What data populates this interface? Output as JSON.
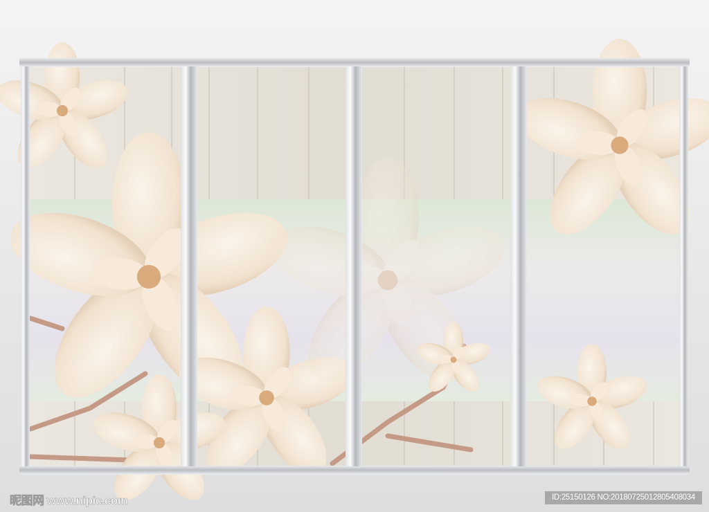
{
  "watermark": {
    "site_logo": "昵图网",
    "site_url": "www.nipic.com",
    "image_id": "ID:25150126 NO:20180725012805408034"
  },
  "colors": {
    "wood": "#e8e3da",
    "band": "#dfe8da",
    "petal": "#f3e6d6",
    "branch": "#c59a85",
    "frame": "#c8cacd"
  }
}
